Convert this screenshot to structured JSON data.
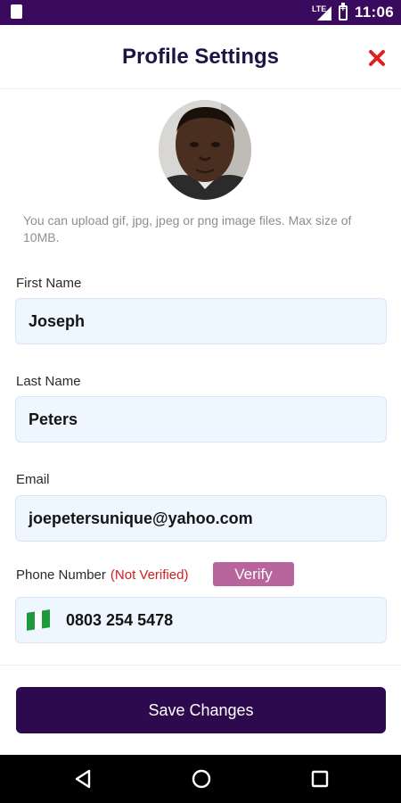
{
  "status_bar": {
    "time": "11:06",
    "network": "LTE"
  },
  "header": {
    "title": "Profile Settings"
  },
  "avatar": {
    "icon": "profile-photo"
  },
  "upload_hint": "You can upload gif, jpg, jpeg or png image files. Max size of 10MB.",
  "form": {
    "first_name": {
      "label": "First Name",
      "value": "Joseph"
    },
    "last_name": {
      "label": "Last Name",
      "value": "Peters"
    },
    "email": {
      "label": "Email",
      "value": "joepetersunique@yahoo.com"
    },
    "phone": {
      "label": "Phone Number",
      "status": "(Not Verified)",
      "verify_label": "Verify",
      "value": "0803 254 5478",
      "flag_icon": "nigeria-flag"
    }
  },
  "save_label": "Save Changes",
  "colors": {
    "status_bar": "#3a0a5e",
    "title": "#1f1346",
    "close": "#e02020",
    "field_bg": "#eef6ff",
    "not_verified": "#d51b1b",
    "verify_button": "#b8659e",
    "save_button": "#2d0a4e"
  }
}
